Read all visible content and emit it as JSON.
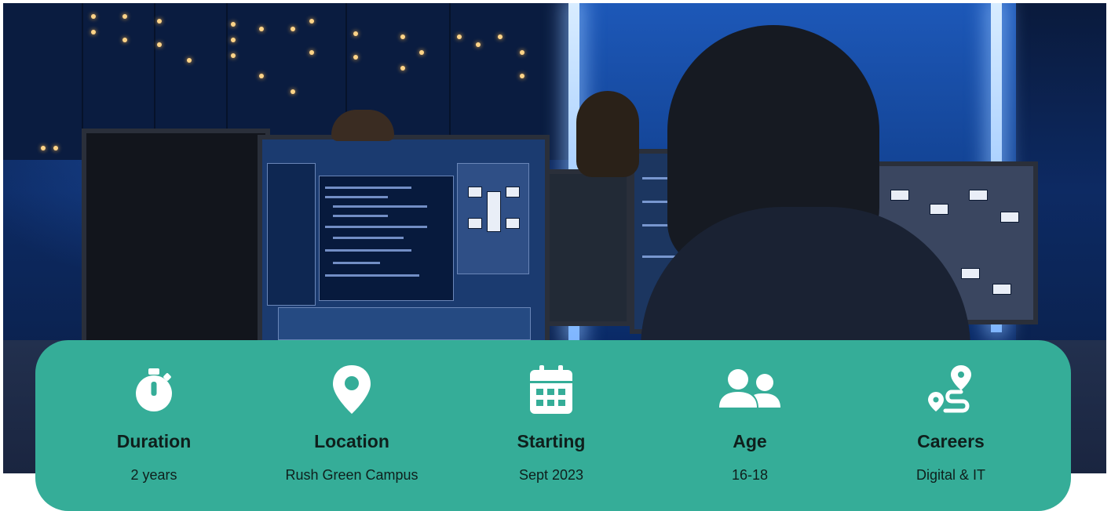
{
  "hero": {
    "image_label": "monitoring-room-photo",
    "accent_color": "#35ad98"
  },
  "stats": [
    {
      "icon": "stopwatch-icon",
      "label": "Duration",
      "value": "2 years"
    },
    {
      "icon": "location-pin-icon",
      "label": "Location",
      "value": "Rush Green Campus"
    },
    {
      "icon": "calendar-icon",
      "label": "Starting",
      "value": "Sept 2023"
    },
    {
      "icon": "users-icon",
      "label": "Age",
      "value": "16-18"
    },
    {
      "icon": "route-icon",
      "label": "Careers",
      "value": "Digital & IT"
    }
  ]
}
